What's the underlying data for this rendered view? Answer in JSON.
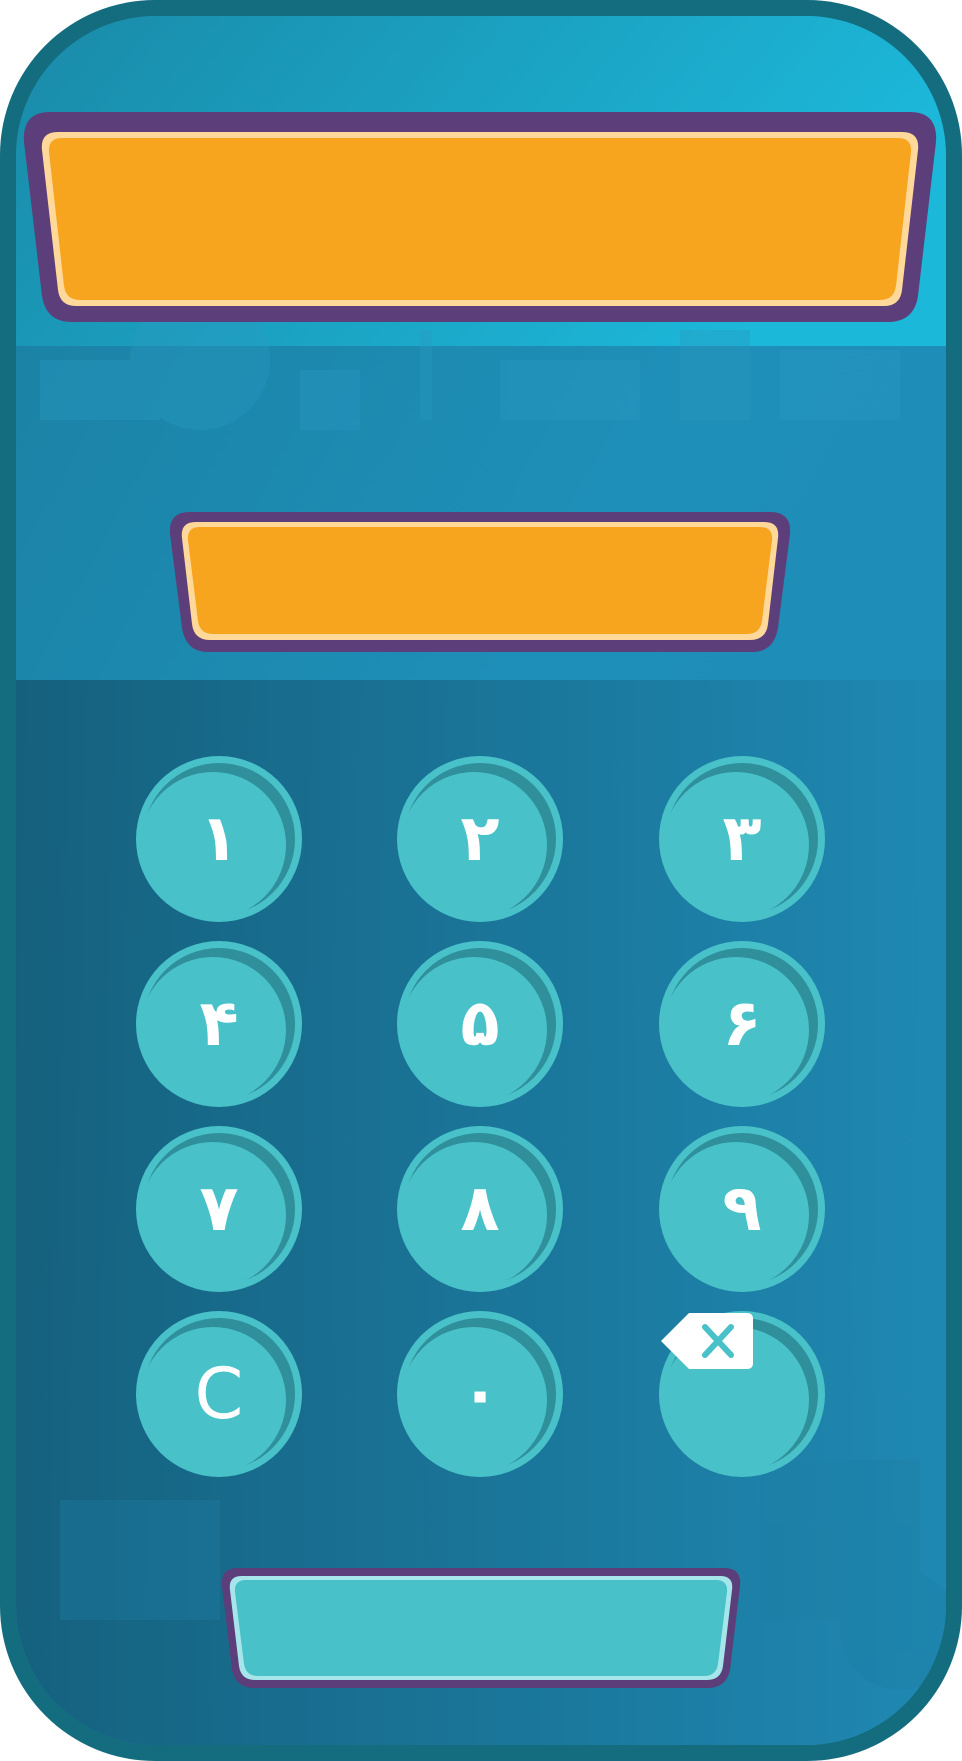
{
  "device": {
    "frame_color": "#136d7e",
    "screen_top_color": "#1cb8da",
    "screen_bottom_color": "#1a6f90",
    "keypad_panel_color": "#16637f"
  },
  "title_banner": {
    "text": "",
    "fill_color": "#f7a51f",
    "border_color": "#5c3f7a",
    "highlight_color": "#ffd89a"
  },
  "answer_display": {
    "value": "",
    "fill_color": "#f7a51f",
    "border_color": "#5c3f7a",
    "highlight_color": "#ffd89a"
  },
  "keypad": {
    "button_color": "#48c1c9",
    "button_shade_color": "#2f8f9b",
    "label_color": "#ffffff",
    "keys": [
      {
        "name": "key-1",
        "label": "١"
      },
      {
        "name": "key-2",
        "label": "٢"
      },
      {
        "name": "key-3",
        "label": "٣"
      },
      {
        "name": "key-4",
        "label": "۴"
      },
      {
        "name": "key-5",
        "label": "۵"
      },
      {
        "name": "key-6",
        "label": "۶"
      },
      {
        "name": "key-7",
        "label": "٧"
      },
      {
        "name": "key-8",
        "label": "٨"
      },
      {
        "name": "key-9",
        "label": "٩"
      },
      {
        "name": "clear-key",
        "label": "C"
      },
      {
        "name": "key-0",
        "label": "٠"
      },
      {
        "name": "backspace-key",
        "label": "",
        "icon": "backspace-icon"
      }
    ]
  },
  "submit_button": {
    "label": "",
    "fill_color": "#48c1c9",
    "border_color": "#5c3f7a",
    "highlight_color": "#a6e6ea"
  }
}
